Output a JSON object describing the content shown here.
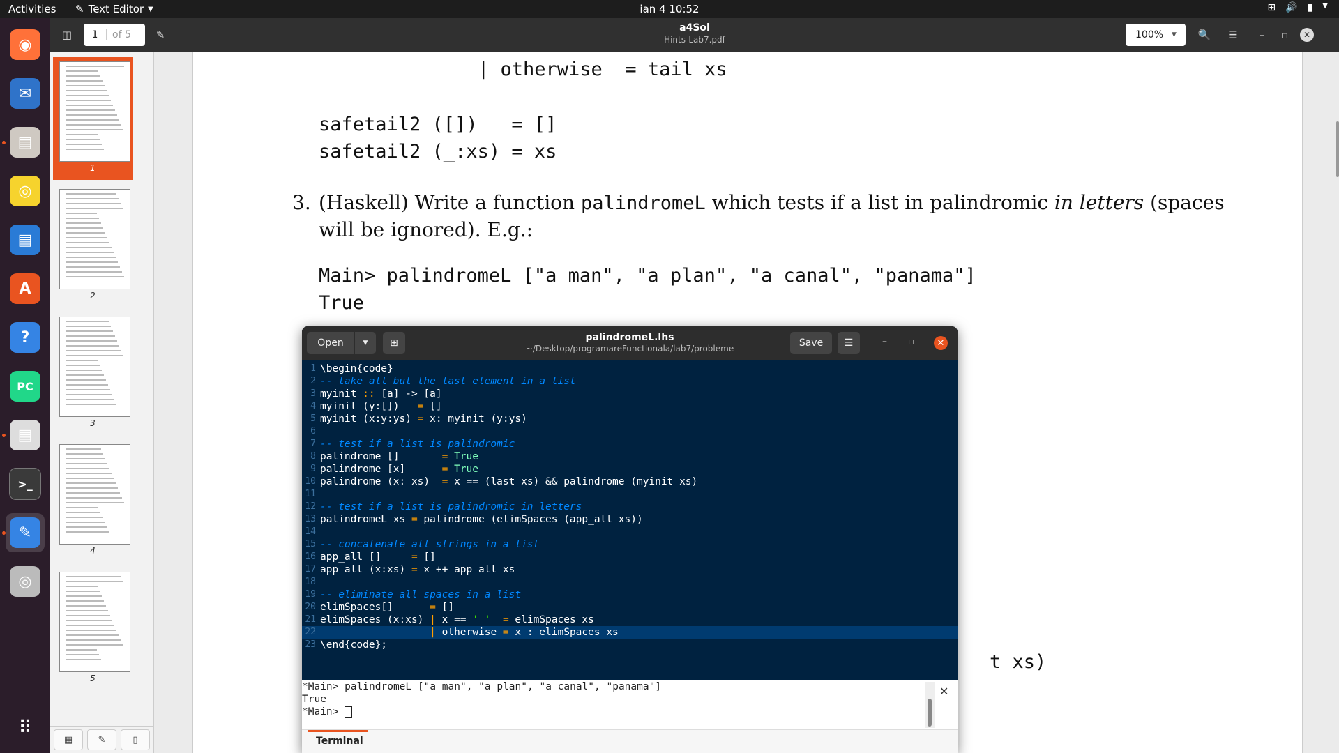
{
  "topbar": {
    "activities": "Activities",
    "app_name": "Text Editor",
    "clock": "ian 4  10:52"
  },
  "dock": {
    "items": [
      {
        "name": "firefox-icon",
        "color": "#ff7139"
      },
      {
        "name": "thunderbird-icon",
        "color": "#2f73c9"
      },
      {
        "name": "files-icon",
        "color": "#cfc9c2"
      },
      {
        "name": "rhythmbox-icon",
        "color": "#f6d32d"
      },
      {
        "name": "libreoffice-writer-icon",
        "color": "#2a7bd6"
      },
      {
        "name": "app-center-icon",
        "color": "#e95420"
      },
      {
        "name": "help-icon",
        "color": "#3584e4"
      },
      {
        "name": "pycharm-icon",
        "color": "#21d789"
      },
      {
        "name": "document-viewer-icon",
        "color": "#dddddd"
      },
      {
        "name": "terminal-icon",
        "color": "#3a3a3a"
      },
      {
        "name": "text-editor-icon",
        "color": "#3584e4"
      },
      {
        "name": "disc-icon",
        "color": "#bbbbbb"
      }
    ],
    "show_apps": "show-apps-icon"
  },
  "viewer": {
    "title": "a4Sol",
    "subtitle": "Hints-Lab7.pdf",
    "page_current": "1",
    "page_of": "of 5",
    "zoom": "100%",
    "thumb_labels": [
      "1",
      "2",
      "3",
      "4",
      "5"
    ]
  },
  "document": {
    "line1": "| otherwise  = tail xs",
    "line2": "safetail2 ([])   = []",
    "line3": "safetail2 (_:xs) = xs",
    "item_number": "3.",
    "para_a": "(Haskell) Write a function ",
    "para_code": "palindromeL",
    "para_b": " which tests if a list in palindromic ",
    "para_em": "in letters",
    "para_c": " (spaces",
    "para_line2": "will be ignored). E.g.:",
    "example1": "Main> palindromeL [\"a man\", \"a plan\", \"a canal\", \"panama\"]",
    "example2": "True",
    "fragment": "t xs)"
  },
  "editor": {
    "open_label": "Open",
    "save_label": "Save",
    "title": "palindromeL.lhs",
    "path": "~/Desktop/programareFunctionala/lab7/probleme",
    "line_numbers": [
      "1",
      "2",
      "3",
      "4",
      "5",
      "6",
      "7",
      "8",
      "9",
      "10",
      "11",
      "12",
      "13",
      "14",
      "15",
      "16",
      "17",
      "18",
      "19",
      "20",
      "21",
      "22",
      "23"
    ],
    "lines": [
      "\\begin{code}",
      "-- take all but the last element in a list",
      "myinit :: [a] -> [a]",
      "myinit (y:[])   = []",
      "myinit (x:y:ys) = x: myinit (y:ys)",
      "",
      "-- test if a list is palindromic",
      "palindrome []       = True",
      "palindrome [x]      = True",
      "palindrome (x: xs)  = x == (last xs) && palindrome (myinit xs)",
      "",
      "-- test if a list is palindromic in letters",
      "palindromeL xs = palindrome (elimSpaces (app_all xs))",
      "",
      "-- concatenate all strings in a list",
      "app_all []     = []",
      "app_all (x:xs) = x ++ app_all xs",
      "",
      "-- eliminate all spaces in a list",
      "elimSpaces[]      = []",
      "elimSpaces (x:xs) | x == ' '  = elimSpaces xs",
      "                  | otherwise = x : elimSpaces xs",
      "\\end{code};"
    ],
    "current_line": 22,
    "terminal_lines": [
      "*Main> palindromeL [\"a man\", \"a plan\", \"a canal\", \"panama\"]",
      "True",
      "*Main> "
    ],
    "terminal_tab": "Terminal"
  }
}
